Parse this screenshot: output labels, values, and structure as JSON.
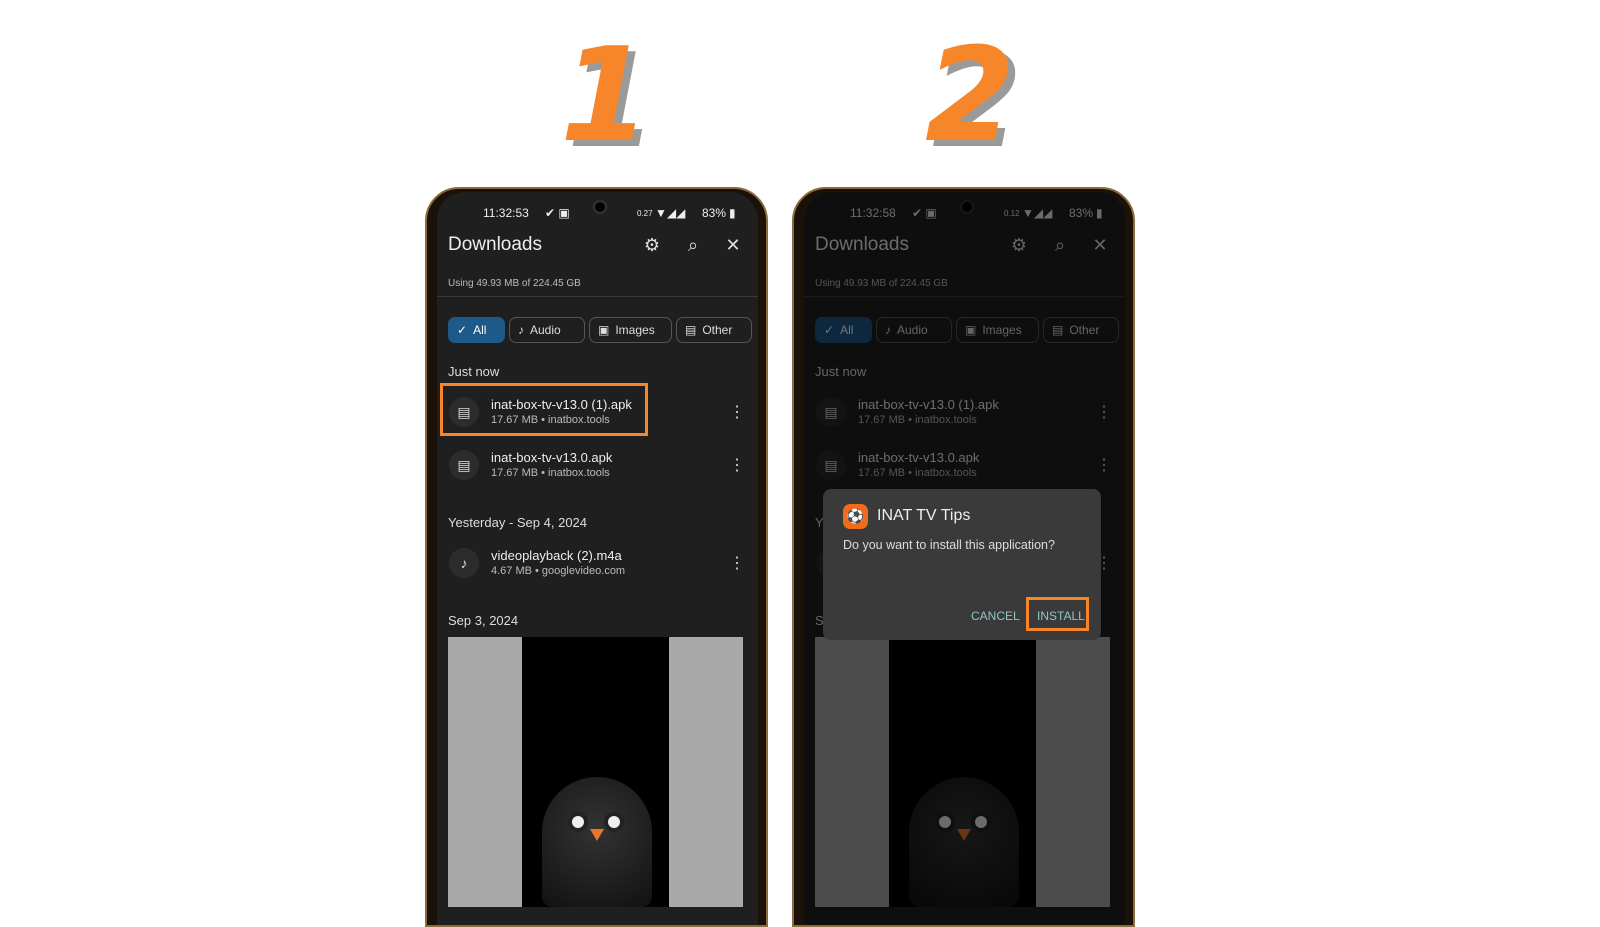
{
  "steps": [
    "1",
    "2"
  ],
  "colors": {
    "accent": "#f7862a",
    "chip_selected": "#1d5a8a",
    "dialog_button": "#8cc7c2"
  },
  "phones": [
    {
      "status": {
        "time": "11:32:53",
        "net_speed": "0.27",
        "battery": "83%"
      }
    },
    {
      "status": {
        "time": "11:32:58",
        "net_speed": "0.12",
        "battery": "83%"
      }
    }
  ],
  "downloads": {
    "title": "Downloads",
    "usage": "Using 49.93 MB of 224.45 GB",
    "icons": {
      "settings": "gear-icon",
      "search": "search-icon",
      "close": "close-icon"
    },
    "chips": [
      {
        "label": "All",
        "icon": "check-icon"
      },
      {
        "label": "Audio",
        "icon": "music-note-icon"
      },
      {
        "label": "Images",
        "icon": "image-icon"
      },
      {
        "label": "Other",
        "icon": "file-icon"
      }
    ],
    "sections": [
      "Just now",
      "Yesterday - Sep 4, 2024",
      "Sep 3, 2024"
    ],
    "items": [
      {
        "name": "inat-box-tv-v13.0 (1).apk",
        "meta": "17.67 MB • inatbox.tools",
        "icon": "file-icon"
      },
      {
        "name": "inat-box-tv-v13.0.apk",
        "meta": "17.67 MB • inatbox.tools",
        "icon": "file-icon"
      },
      {
        "name": "videoplayback (2).m4a",
        "meta": "4.67 MB • googlevideo.com",
        "icon": "music-note-icon"
      }
    ]
  },
  "dialog": {
    "app_name": "INAT TV Tips",
    "message": "Do you want to install this application?",
    "cancel": "CANCEL",
    "install": "INSTALL"
  }
}
